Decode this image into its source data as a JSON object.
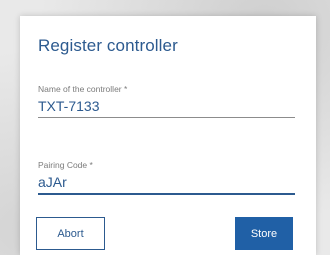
{
  "dialog": {
    "title": "Register controller",
    "fields": [
      {
        "label": "Name of the controller *",
        "value": "TXT-7133"
      },
      {
        "label": "Pairing Code *",
        "value": "aJAr"
      }
    ],
    "buttons": {
      "abort_label": "Abort",
      "store_label": "Store"
    }
  },
  "colors": {
    "accent": "#2c5a8f",
    "primary_button": "#2060a6",
    "label_gray": "#7b7b7b"
  }
}
